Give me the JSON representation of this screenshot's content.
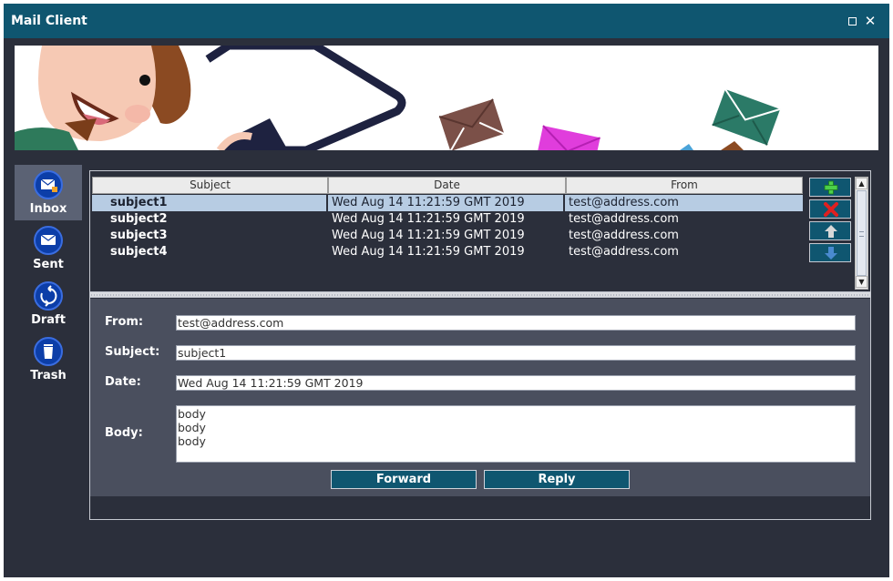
{
  "window": {
    "title": "Mail Client",
    "maximize_icon": "maximize-icon",
    "close_icon": "close-icon"
  },
  "sidebar": {
    "items": [
      {
        "label": "Inbox",
        "icon": "inbox-icon",
        "active": true
      },
      {
        "label": "Sent",
        "icon": "sent-icon",
        "active": false
      },
      {
        "label": "Draft",
        "icon": "draft-icon",
        "active": false
      },
      {
        "label": "Trash",
        "icon": "trash-icon",
        "active": false
      }
    ]
  },
  "table": {
    "columns": [
      "Subject",
      "Date",
      "From"
    ],
    "rows": [
      {
        "subject": "subject1",
        "date": "Wed Aug 14 11:21:59 GMT 2019",
        "from": "test@address.com",
        "selected": true
      },
      {
        "subject": "subject2",
        "date": "Wed Aug 14 11:21:59 GMT 2019",
        "from": "test@address.com",
        "selected": false
      },
      {
        "subject": "subject3",
        "date": "Wed Aug 14 11:21:59 GMT 2019",
        "from": "test@address.com",
        "selected": false
      },
      {
        "subject": "subject4",
        "date": "Wed Aug 14 11:21:59 GMT 2019",
        "from": "test@address.com",
        "selected": false
      }
    ],
    "buttons": [
      "add-icon",
      "delete-icon",
      "move-up-icon",
      "move-down-icon"
    ]
  },
  "detail": {
    "from_label": "From:",
    "from_value": "test@address.com",
    "subject_label": "Subject:",
    "subject_value": "subject1",
    "date_label": "Date:",
    "date_value": "Wed Aug 14 11:21:59 GMT 2019",
    "body_label": "Body:",
    "body_lines": [
      "body",
      "body",
      "body"
    ],
    "forward_label": "Forward",
    "reply_label": "Reply"
  },
  "colors": {
    "titlebar": "#0f5670",
    "background": "#2b2f3b",
    "detail_panel": "#4a4f5e",
    "selected_row": "#b7cce3",
    "sidebar_icon": "#0c3ea8"
  }
}
